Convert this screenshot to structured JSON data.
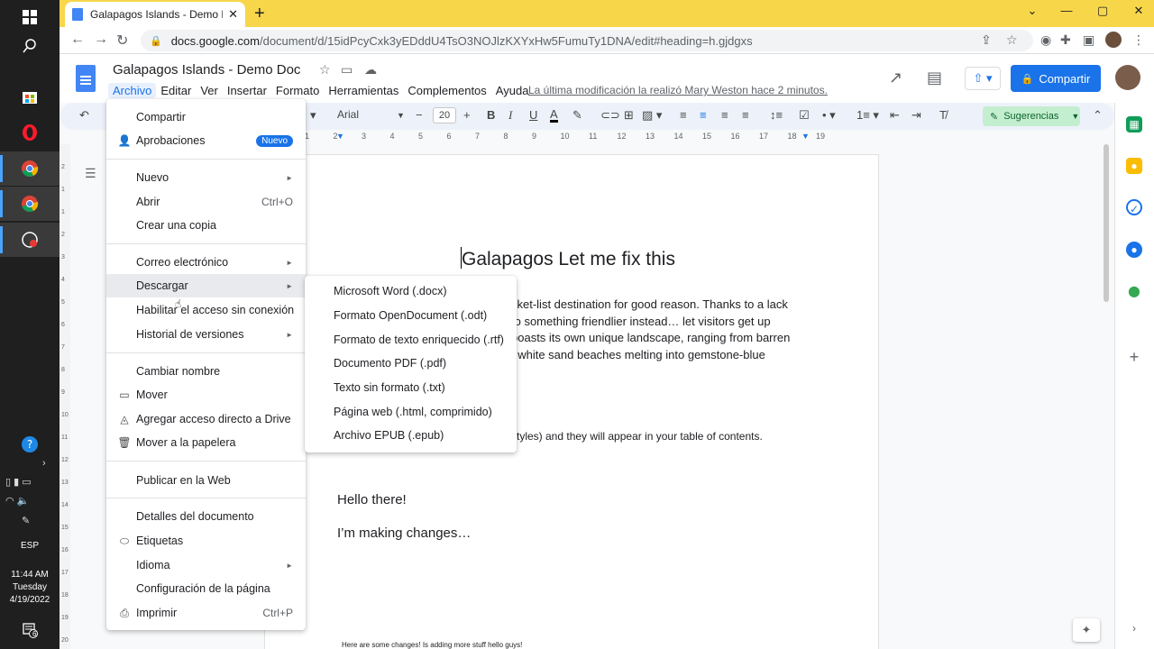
{
  "browser": {
    "tab_title": "Galapagos Islands - Demo Doc - Goo",
    "url_host": "docs.google.com",
    "url_path": "/document/d/15idPcyCxk3yEDddU4TsO3NOJlzKXYxHw5FumuTy1DNA/edit#heading=h.gjdgxs"
  },
  "taskbar": {
    "language": "ESP",
    "time": "11:44 AM",
    "day": "Tuesday",
    "date": "4/19/2022",
    "notification_count": "6"
  },
  "docs": {
    "title": "Galapagos Islands - Demo Doc",
    "menus": [
      "Archivo",
      "Editar",
      "Ver",
      "Insertar",
      "Formato",
      "Herramientas",
      "Complementos",
      "Ayuda"
    ],
    "last_edit": "La última modificación la realizó Mary Weston hace 2 minutos.",
    "share_label": "Compartir",
    "suggest_label": "Sugerencias",
    "font_name": "Arial",
    "font_size": "20"
  },
  "ruler": [
    "1",
    "2",
    "3",
    "4",
    "5",
    "6",
    "7",
    "8",
    "9",
    "10",
    "11",
    "12",
    "13",
    "14",
    "15",
    "16",
    "17",
    "18",
    "19"
  ],
  "vruler": [
    "2",
    "1",
    "1",
    "2",
    "3",
    "4",
    "5",
    "6",
    "7",
    "8",
    "9",
    "10",
    "11",
    "12",
    "13",
    "14",
    "15",
    "16",
    "17",
    "18",
    "19",
    "20"
  ],
  "document": {
    "heading": "Galapagos Let me fix this",
    "para_lines": [
      "cket-list destination for good reason. Thanks to a lack",
      "to something friendlier instead…  let visitors get up",
      "boasts its own unique landscape, ranging from barren",
      "f white sand beaches melting into gemstone-blue"
    ],
    "toc_line": "styles) and they will appear in your table of contents.",
    "hello": "Hello there!",
    "changes": "I’m making changes…",
    "footer": "Here are some changes! Is adding more stuff hello guys!"
  },
  "file_menu": {
    "compartir": "Compartir",
    "aprobaciones": "Aprobaciones",
    "nuevo_badge": "Nuevo",
    "nuevo": "Nuevo",
    "abrir": "Abrir",
    "abrir_shortcut": "Ctrl+O",
    "copia": "Crear una copia",
    "correo": "Correo electrónico",
    "descargar": "Descargar",
    "offline": "Habilitar el acceso sin conexión",
    "historial": "Historial de versiones",
    "renombrar": "Cambiar nombre",
    "mover": "Mover",
    "acceso_directo": "Agregar acceso directo a Drive",
    "papelera": "Mover a la papelera",
    "publicar": "Publicar en la Web",
    "detalles": "Detalles del documento",
    "etiquetas": "Etiquetas",
    "idioma": "Idioma",
    "config_pagina": "Configuración de la página",
    "imprimir": "Imprimir",
    "imprimir_shortcut": "Ctrl+P"
  },
  "download_menu": [
    "Microsoft Word (.docx)",
    "Formato OpenDocument (.odt)",
    "Formato de texto enriquecido (.rtf)",
    "Documento PDF (.pdf)",
    "Texto sin formato (.txt)",
    "Página web (.html, comprimido)",
    "Archivo EPUB (.epub)"
  ],
  "colors": {
    "accent": "#1a73e8",
    "tabbar": "#f7d64a",
    "suggest": "#c4eed0"
  }
}
